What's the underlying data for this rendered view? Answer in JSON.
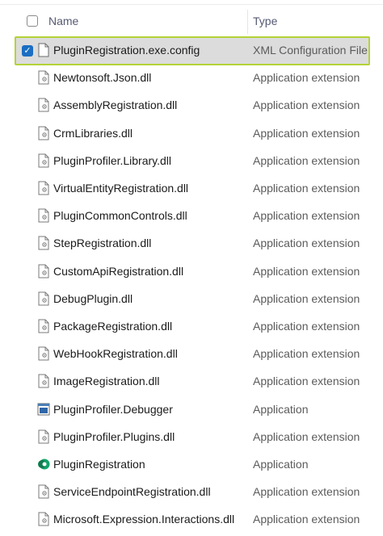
{
  "header": {
    "name_label": "Name",
    "type_label": "Type"
  },
  "files": [
    {
      "name": "PluginRegistration.exe.config",
      "type": "XML Configuration File",
      "icon": "document-icon",
      "selected": true
    },
    {
      "name": "Newtonsoft.Json.dll",
      "type": "Application extension",
      "icon": "dll-icon"
    },
    {
      "name": "AssemblyRegistration.dll",
      "type": "Application extension",
      "icon": "dll-icon"
    },
    {
      "name": "CrmLibraries.dll",
      "type": "Application extension",
      "icon": "dll-icon"
    },
    {
      "name": "PluginProfiler.Library.dll",
      "type": "Application extension",
      "icon": "dll-icon"
    },
    {
      "name": "VirtualEntityRegistration.dll",
      "type": "Application extension",
      "icon": "dll-icon"
    },
    {
      "name": "PluginCommonControls.dll",
      "type": "Application extension",
      "icon": "dll-icon"
    },
    {
      "name": "StepRegistration.dll",
      "type": "Application extension",
      "icon": "dll-icon"
    },
    {
      "name": "CustomApiRegistration.dll",
      "type": "Application extension",
      "icon": "dll-icon"
    },
    {
      "name": "DebugPlugin.dll",
      "type": "Application extension",
      "icon": "dll-icon"
    },
    {
      "name": "PackageRegistration.dll",
      "type": "Application extension",
      "icon": "dll-icon"
    },
    {
      "name": "WebHookRegistration.dll",
      "type": "Application extension",
      "icon": "dll-icon"
    },
    {
      "name": "ImageRegistration.dll",
      "type": "Application extension",
      "icon": "dll-icon"
    },
    {
      "name": "PluginProfiler.Debugger",
      "type": "Application",
      "icon": "exe-window-icon"
    },
    {
      "name": "PluginProfiler.Plugins.dll",
      "type": "Application extension",
      "icon": "dll-icon"
    },
    {
      "name": "PluginRegistration",
      "type": "Application",
      "icon": "plugin-registration-app-icon"
    },
    {
      "name": "ServiceEndpointRegistration.dll",
      "type": "Application extension",
      "icon": "dll-icon"
    },
    {
      "name": "Microsoft.Expression.Interactions.dll",
      "type": "Application extension",
      "icon": "dll-icon"
    }
  ]
}
